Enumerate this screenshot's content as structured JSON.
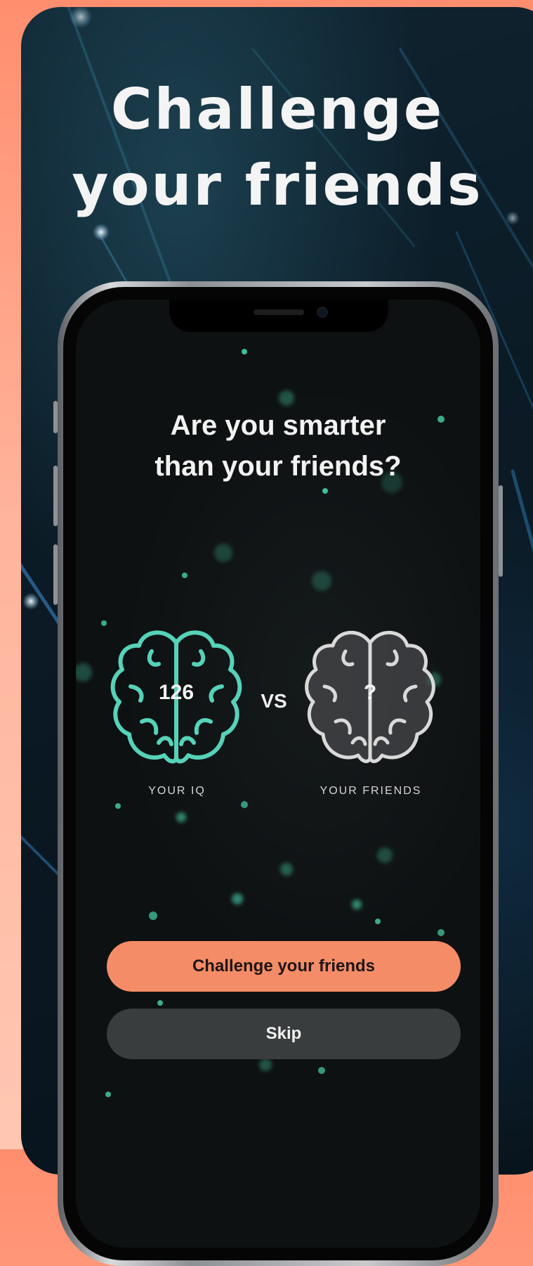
{
  "promo": {
    "headline_line1": "Challenge",
    "headline_line2": "your friends"
  },
  "screen": {
    "question_line1": "Are you smarter",
    "question_line2": "than your friends?",
    "your_iq_value": "126",
    "friends_value": "?",
    "vs_label": "VS",
    "your_iq_label": "YOUR IQ",
    "friends_label": "YOUR FRIENDS",
    "primary_button": "Challenge your friends",
    "secondary_button": "Skip"
  },
  "colors": {
    "accent": "#f48c68",
    "brain_teal": "#55d2b8",
    "brain_grey": "#d9d9d9",
    "background": "#0b1b26"
  }
}
